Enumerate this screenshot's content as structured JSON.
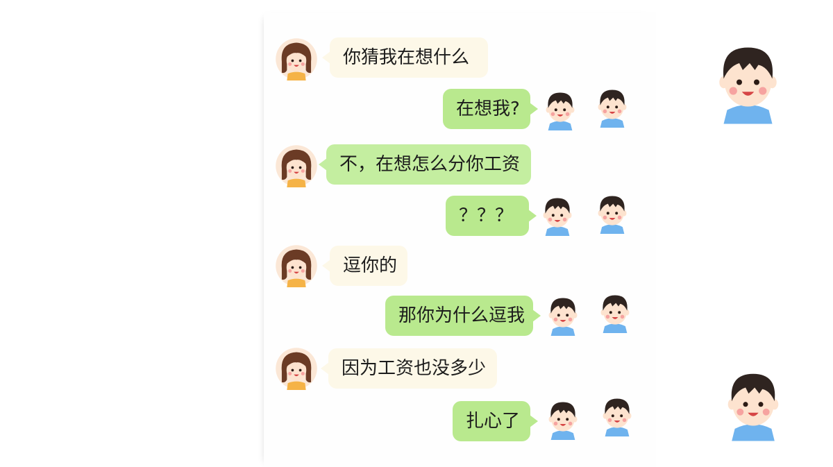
{
  "chat": {
    "messages": [
      {
        "sender": "girl",
        "text": "你猜我在想什么"
      },
      {
        "sender": "boy",
        "text": "在想我?"
      },
      {
        "sender": "girl",
        "text": "不，在想怎么分你工资"
      },
      {
        "sender": "boy",
        "text": "？？？"
      },
      {
        "sender": "girl",
        "text": "逗你的"
      },
      {
        "sender": "boy",
        "text": "那你为什么逗我"
      },
      {
        "sender": "girl",
        "text": "因为工资也没多少"
      },
      {
        "sender": "boy",
        "text": "扎心了"
      }
    ]
  },
  "icons": {
    "girl_avatar": "girl-avatar-icon",
    "boy_avatar": "boy-avatar-icon",
    "boy_illustration": "boy-illustration-icon"
  },
  "colors": {
    "girl_bubble": "#fdf8e8",
    "girl_bubble_alt": "#c4eea0",
    "boy_bubble": "#b9e98e",
    "boy_shirt": "#6fb3ee",
    "hair": "#2f2420"
  }
}
